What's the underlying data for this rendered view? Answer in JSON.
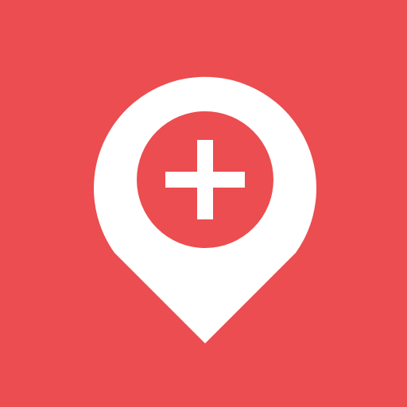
{
  "icon": {
    "name": "map-pin-plus-icon",
    "colors": {
      "background": "#EB4D50",
      "pin": "#FFFFFF",
      "inner_circle": "#EB4D50",
      "plus": "#FFFFFF"
    }
  }
}
